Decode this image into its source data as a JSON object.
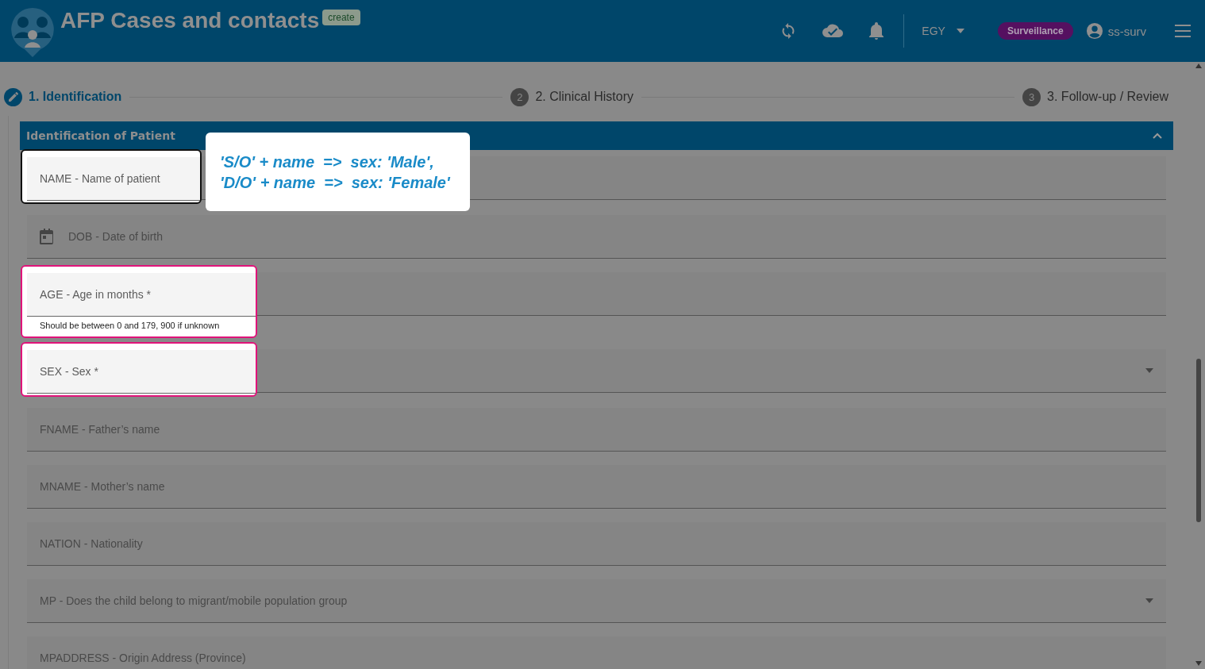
{
  "header": {
    "title": "AFP Cases and contacts",
    "mode_badge": "create",
    "country": "EGY",
    "role": "Surveillance",
    "user": "ss-surv"
  },
  "steps": [
    {
      "label": "1. Identification",
      "selected": true
    },
    {
      "number": "2",
      "label": "2. Clinical History",
      "selected": false
    },
    {
      "number": "3",
      "label": "3. Follow-up / Review",
      "selected": false
    }
  ],
  "section": {
    "title": "Identification of Patient",
    "expanded": true
  },
  "fields": [
    {
      "kind": "text",
      "label": "NAME - Name of patient",
      "color": "#111111"
    },
    {
      "kind": "date",
      "label": "DOB - Date of birth"
    },
    {
      "kind": "text",
      "label": "AGE - Age in months *",
      "helper": "Should be between 0 and 179, 900 if unknown",
      "color": "#e0147a"
    },
    {
      "kind": "select",
      "label": "SEX - Sex *",
      "color": "#e0147a"
    },
    {
      "kind": "text",
      "label": "FNAME - Father’s name"
    },
    {
      "kind": "text",
      "label": "MNAME - Mother’s name"
    },
    {
      "kind": "text",
      "label": "NATION - Nationality"
    },
    {
      "kind": "select",
      "label": "MP - Does the child belong to migrant/mobile population group"
    },
    {
      "kind": "text",
      "label": "MPADDRESS - Origin Address (Province)"
    }
  ],
  "tip": {
    "lines": [
      "'S/O' + name  =>  sex: 'Male',",
      "'D/O' + name  =>  sex: 'Female'"
    ]
  }
}
